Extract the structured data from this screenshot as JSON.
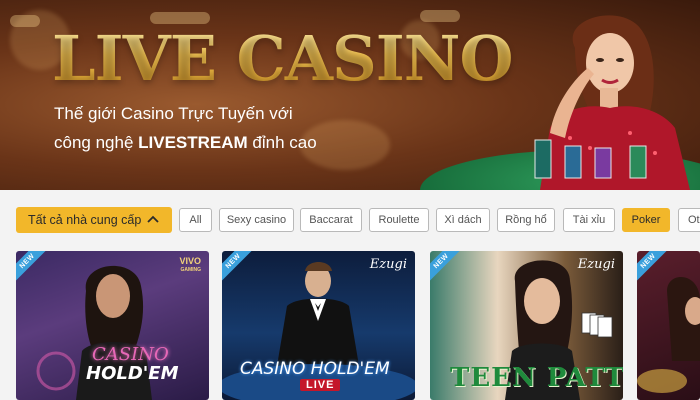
{
  "hero": {
    "title": "LIVE CASINO",
    "subtitle_line1": "Thế giới Casino Trực Tuyến với",
    "subtitle_line2_prefix": "công nghệ ",
    "subtitle_line2_bold": "LIVESTREAM",
    "subtitle_line2_suffix": " đỉnh cao"
  },
  "filters": {
    "provider_label": "Tất cả nhà cung cấp",
    "chips": [
      "All",
      "Sexy casino",
      "Baccarat",
      "Roulette",
      "Xì dách",
      "Rồng hổ",
      "Tài xỉu",
      "Poker",
      "Oth"
    ],
    "active_chip": "Poker",
    "accent_color": "#f2b72a"
  },
  "games": [
    {
      "badge": "NEW",
      "provider_logo": "VIVO",
      "provider_logo_sub": "GAMING",
      "title_line1": "CASINO",
      "title_line2": "HOLD'EM"
    },
    {
      "badge": "NEW",
      "provider_logo": "Ezugi",
      "title_line1": "CASINO HOLD'EM",
      "title_line2": "LIVE"
    },
    {
      "badge": "NEW",
      "provider_logo": "Ezugi",
      "title_line1": "TEEN PATTI"
    },
    {
      "badge": "NEW"
    }
  ],
  "colors": {
    "badge": "#3aa0dc",
    "gold": "#f1c45a",
    "page_bg": "#f3f3f3"
  }
}
